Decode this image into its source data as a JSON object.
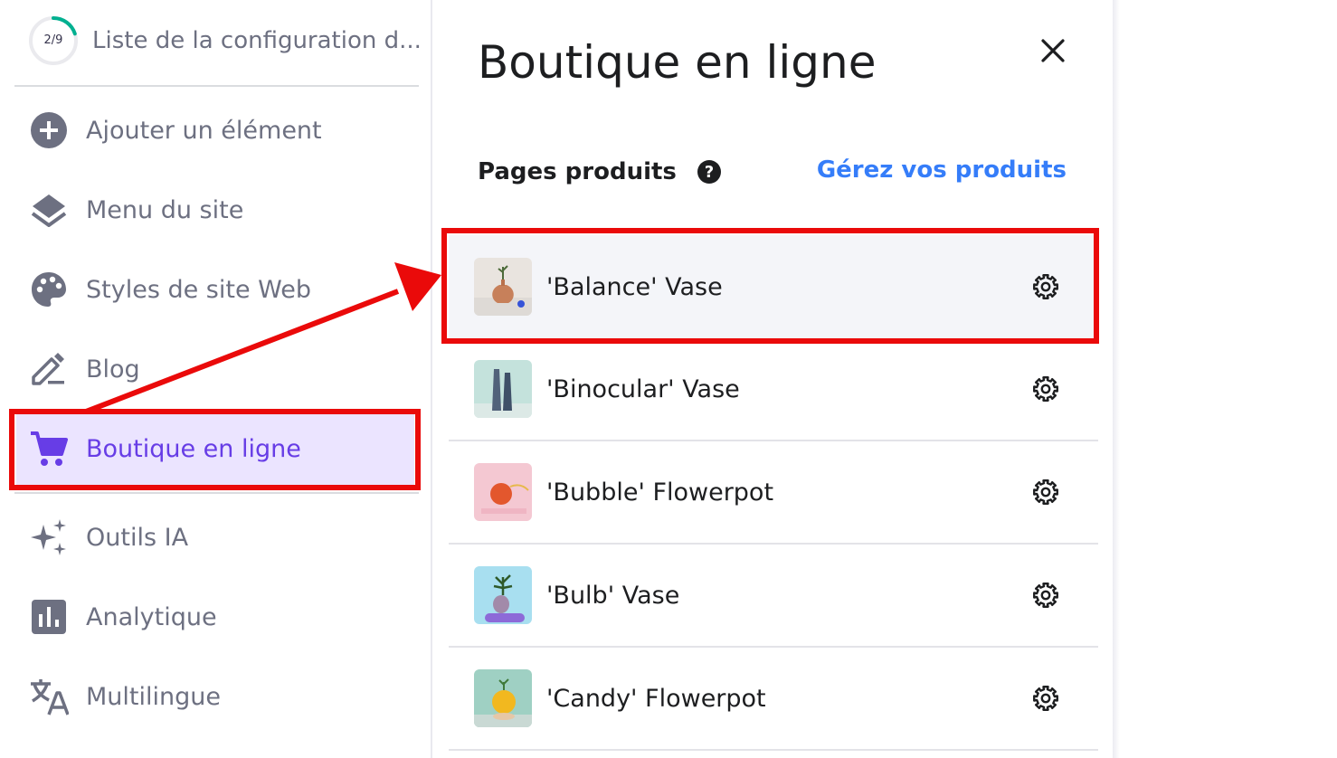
{
  "setup": {
    "progress": "2/9",
    "progress_fraction": 0.222,
    "label": "Liste de la configuration d..."
  },
  "sidebar": {
    "items": [
      {
        "label": "Ajouter un élément",
        "icon": "plus-circle-icon"
      },
      {
        "label": "Menu du site",
        "icon": "layers-icon"
      },
      {
        "label": "Styles de site Web",
        "icon": "palette-icon"
      },
      {
        "label": "Blog",
        "icon": "edit-icon"
      },
      {
        "label": "Boutique en ligne",
        "icon": "cart-icon",
        "active": true
      },
      {
        "label": "Outils IA",
        "icon": "sparkles-icon"
      },
      {
        "label": "Analytique",
        "icon": "bar-chart-icon"
      },
      {
        "label": "Multilingue",
        "icon": "translate-icon"
      }
    ]
  },
  "panel": {
    "title": "Boutique en ligne",
    "section_title": "Pages produits",
    "manage_link": "Gérez vos produits",
    "products": [
      {
        "name": "'Balance' Vase",
        "selected": true
      },
      {
        "name": "'Binocular' Vase"
      },
      {
        "name": "'Bubble' Flowerpot"
      },
      {
        "name": "'Bulb' Vase"
      },
      {
        "name": "'Candy' Flowerpot"
      }
    ]
  },
  "colors": {
    "accent": "#673de6",
    "accent_bg": "#ebe4ff",
    "link": "#357df9",
    "annotation": "#ea0a0a",
    "progress_ring": "#00b090",
    "icon_gray": "#6d7081"
  }
}
